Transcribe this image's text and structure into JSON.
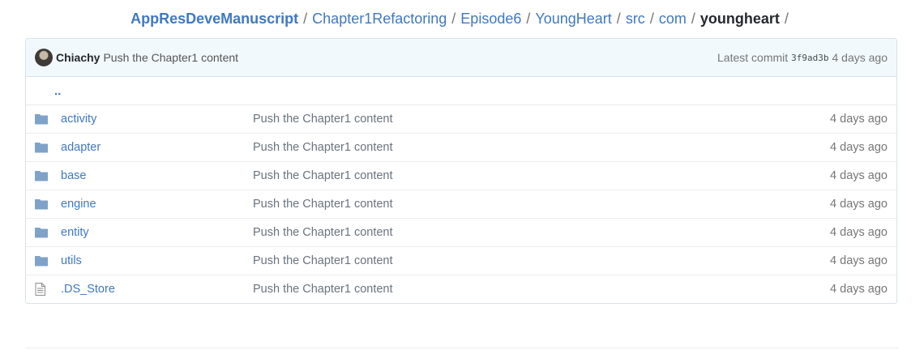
{
  "breadcrumb": {
    "repo": "AppResDeveManuscript",
    "segments": [
      "Chapter1Refactoring",
      "Episode6",
      "YoungHeart",
      "src",
      "com"
    ],
    "current": "youngheart",
    "separator": "/"
  },
  "commit": {
    "author": "Chiachy",
    "message": "Push the Chapter1 content",
    "latest_label": "Latest commit",
    "sha": "3f9ad3b",
    "age": "4 days ago"
  },
  "up_link": "..",
  "files": [
    {
      "name": "activity",
      "type": "folder",
      "message": "Push the Chapter1 content",
      "age": "4 days ago"
    },
    {
      "name": "adapter",
      "type": "folder",
      "message": "Push the Chapter1 content",
      "age": "4 days ago"
    },
    {
      "name": "base",
      "type": "folder",
      "message": "Push the Chapter1 content",
      "age": "4 days ago"
    },
    {
      "name": "engine",
      "type": "folder",
      "message": "Push the Chapter1 content",
      "age": "4 days ago"
    },
    {
      "name": "entity",
      "type": "folder",
      "message": "Push the Chapter1 content",
      "age": "4 days ago"
    },
    {
      "name": "utils",
      "type": "folder",
      "message": "Push the Chapter1 content",
      "age": "4 days ago"
    },
    {
      "name": ".DS_Store",
      "type": "file",
      "message": "Push the Chapter1 content",
      "age": "4 days ago"
    }
  ],
  "colors": {
    "link": "#4078c0",
    "folder_icon": "#7fa3c8",
    "commit_bar_bg": "#f2f9fc"
  }
}
